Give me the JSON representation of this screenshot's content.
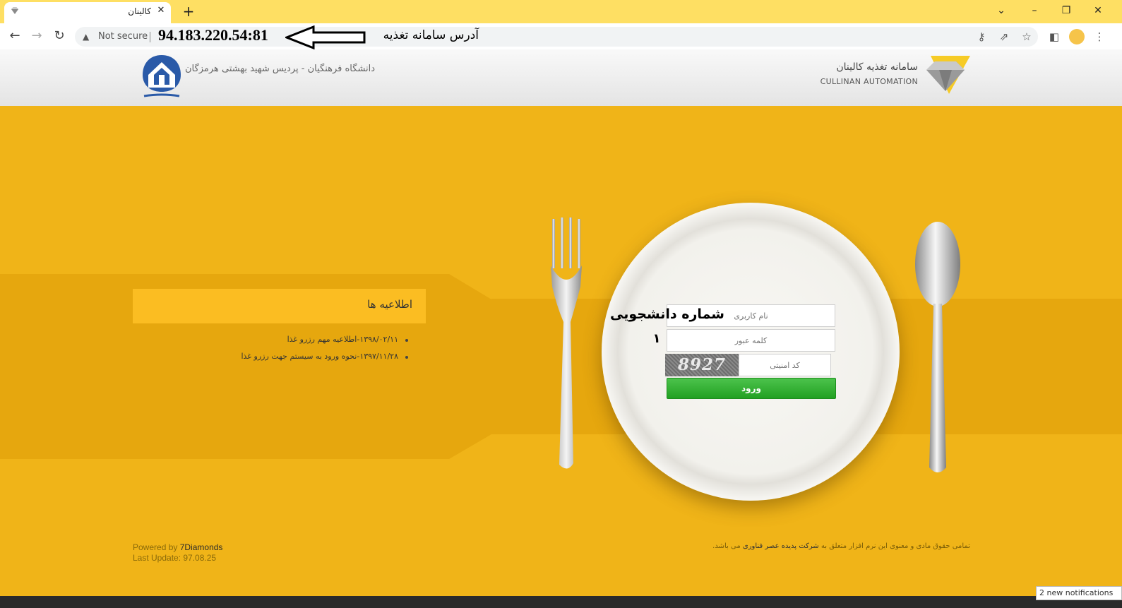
{
  "browser": {
    "tab_title": "کالینان",
    "new_tab_icon": "plus-icon",
    "address": {
      "security_label": "Not secure",
      "url": "94.183.220.54:81"
    },
    "annotation_address": "آدرس سامانه تغذیه"
  },
  "header": {
    "university_name": "دانشگاه فرهنگیان - پردیس شهید بهشتی هرمزگان",
    "brand_title": "سامانه تغذیه کالینان",
    "brand_subtitle": "CULLINAN AUTOMATION"
  },
  "announcements": {
    "title": "اطلاعیه ها",
    "items": [
      "۱۳۹۸/۰۲/۱۱-اطلاعیه مهم رزرو غذا",
      "۱۳۹۷/۱۱/۲۸-نحوه ورود به سیستم جهت رزرو غذا"
    ]
  },
  "login": {
    "username_placeholder": "نام کاربری",
    "password_placeholder": "کلمه عبور",
    "captcha_placeholder": "کد امنیتی",
    "captcha_code": "8927",
    "submit_label": "ورود",
    "annotation_username": "شماره دانشجویی",
    "annotation_password": "۱"
  },
  "footer": {
    "powered_prefix": "Powered by",
    "powered_link": "7Diamonds",
    "last_update": "Last Update: 97.08.25",
    "copyright_prefix": "تمامی حقوق مادی و معنوی این نرم افزار متعلق به",
    "copyright_company": "شرکت پدیده عصر فناوری",
    "copyright_suffix": "می باشد."
  },
  "notification": "2 new notifications",
  "colors": {
    "page_background": "#f0b418",
    "band": "#e6a70e",
    "login_button": "#22a022",
    "tab_strip": "#fedf63"
  }
}
